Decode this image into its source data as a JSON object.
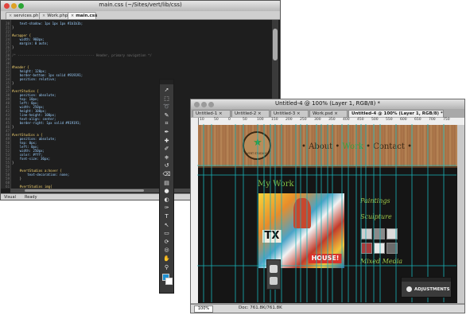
{
  "editor": {
    "title": "main.css (~/Sites/vert/lib/css)",
    "tabs": [
      {
        "label": "services.php",
        "active": false
      },
      {
        "label": "Work.php",
        "active": false
      },
      {
        "label": "main.css",
        "active": true
      }
    ],
    "line_numbers": [
      "20",
      "21",
      "22",
      "23",
      "24",
      "25",
      "26",
      "27",
      "28",
      "29",
      "30",
      "31",
      "32",
      "33",
      "34",
      "35",
      "36",
      "37",
      "38",
      "39",
      "40",
      "41",
      "42",
      "43",
      "44",
      "45",
      "46",
      "47",
      "48",
      "49",
      "50",
      "51",
      "52",
      "53",
      "54",
      "55",
      "56",
      "57",
      "58",
      "59",
      "60",
      "61"
    ],
    "code_lines": [
      "    text-shadow: 1px 1px 1px #1b1b1b;",
      "}",
      "",
      "#wrapper {",
      "    width: 960px;",
      "    margin: 0 auto;",
      "}",
      "",
      "/* ---------------------------------------- Header, primary navigation */",
      "",
      "",
      "#header {",
      "    height: 120px;",
      "    border-bottom: 1px solid #919191;",
      "    position: relative;",
      "}",
      "",
      "#vertStudios {",
      "    position: absolute;",
      "    top: 10px;",
      "    left: 0px;",
      "    width: 250px;",
      "    height: 100px;",
      "    line-height: 100px;",
      "    text-align: center;",
      "    border-right: 1px solid #919191;",
      "}",
      "",
      "#vertStudios a {",
      "    position: absolute;",
      "    top: 0px;",
      "    left: 0px;",
      "    width: 250px;",
      "    color: #fff;",
      "    font-size: 36px;",
      "}",
      "",
      "    #vertStudios a:hover {",
      "        text-decoration: none;",
      "    }",
      "",
      "    #vertStudios img{"
    ],
    "status": {
      "mode": "Visual",
      "state": "Ready"
    }
  },
  "tools_panel": {
    "tools": [
      "move-tool",
      "marquee-tool",
      "lasso-tool",
      "quick-select-tool",
      "crop-tool",
      "eyedropper-tool",
      "healing-tool",
      "brush-tool",
      "stamp-tool",
      "history-brush-tool",
      "eraser-tool",
      "gradient-tool",
      "blur-tool",
      "dodge-tool",
      "pen-tool",
      "type-tool",
      "path-select-tool",
      "shape-tool",
      "3d-rotate-tool",
      "3d-orbit-tool",
      "hand-tool",
      "zoom-tool"
    ],
    "foreground_color": "#1f8fd0",
    "background_color": "#ffffff"
  },
  "photoshop": {
    "title": "Untitled-4 @ 100% (Layer 1, RGB/8) *",
    "tabs": [
      {
        "label": "Untitled-1",
        "active": false
      },
      {
        "label": "Untitled-2",
        "active": false
      },
      {
        "label": "Untitled-3",
        "active": false
      },
      {
        "label": "Work.psd",
        "active": false
      },
      {
        "label": "Untitled-4 @ 100% (Layer 1, RGB/8) *",
        "active": true
      }
    ],
    "ruler_labels": [
      "10",
      "50",
      "0",
      "50",
      "100",
      "150",
      "200",
      "250",
      "300",
      "350",
      "400",
      "450",
      "500",
      "550",
      "600",
      "650",
      "700",
      "750"
    ],
    "zoom": "100%",
    "doc_size": "Doc: 761.8K/761.8K",
    "design": {
      "logo_ring_text": "VERT STUDIOS",
      "nav": [
        "About",
        "Work",
        "Contact"
      ],
      "nav_active": "Work",
      "section_title": "My Work",
      "collage_text_1": "TX",
      "collage_text_2": "HOUSE!",
      "side_labels": [
        "Paintings",
        "Sculpture",
        "Mixed Media"
      ]
    },
    "guide_color": "#19b3b8"
  },
  "adjustments_panel": {
    "label": "ADJUSTMENTS"
  },
  "colors": {
    "editor_bg": "#1e1e1e",
    "accent_green": "#7fbf44",
    "header_wood": "#b07a4d"
  }
}
